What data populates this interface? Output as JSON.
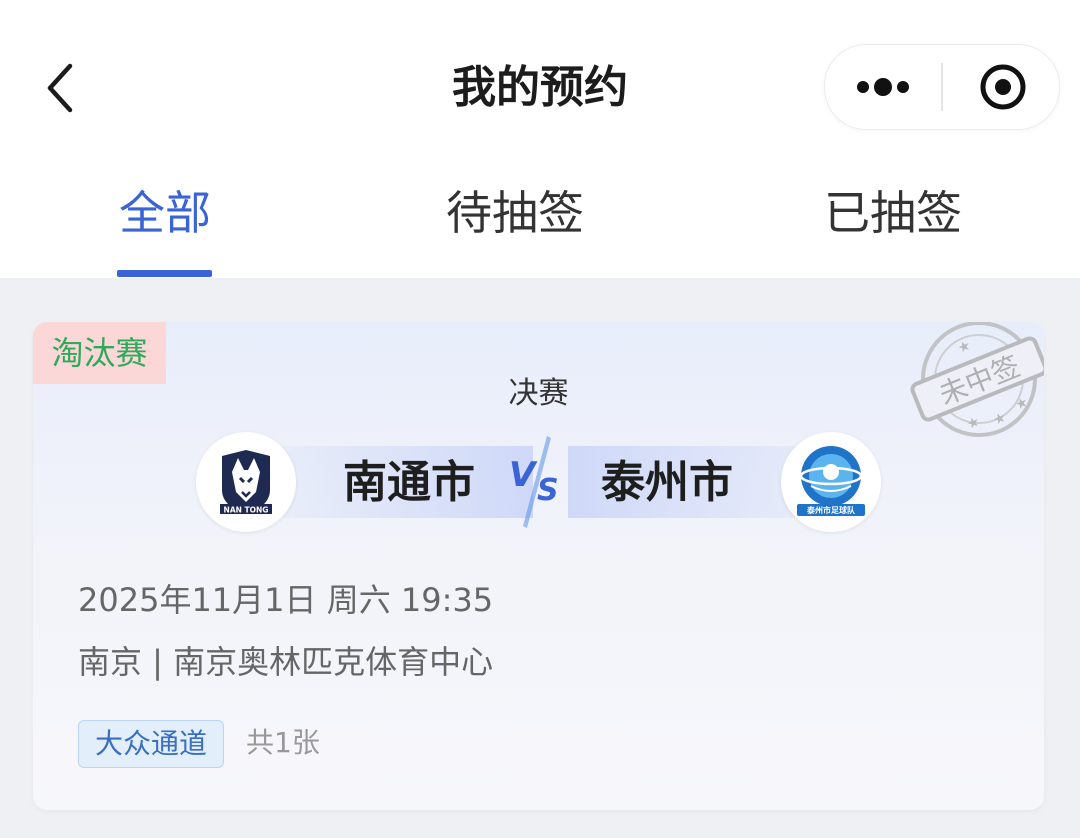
{
  "header": {
    "title": "我的预约"
  },
  "tabs": [
    {
      "label": "全部",
      "active": true
    },
    {
      "label": "待抽签",
      "active": false
    },
    {
      "label": "已抽签",
      "active": false
    }
  ],
  "card": {
    "tag": "淘汰赛",
    "stamp": "未中签",
    "round": "决赛",
    "home_team": {
      "name": "南通市",
      "logo_text": "NAN TONG"
    },
    "away_team": {
      "name": "泰州市",
      "logo_text": "泰州市足球队"
    },
    "datetime": "2025年11月1日  周六 19:35",
    "venue": "南京 | 南京奥林匹克体育中心",
    "channel": "大众通道",
    "count": "共1张"
  },
  "colors": {
    "accent": "#3a63d6",
    "tag_bg": "#fbd7d7",
    "tag_text": "#2faa5a",
    "badge_bg": "#e3eefb",
    "badge_text": "#3a6ec0"
  }
}
